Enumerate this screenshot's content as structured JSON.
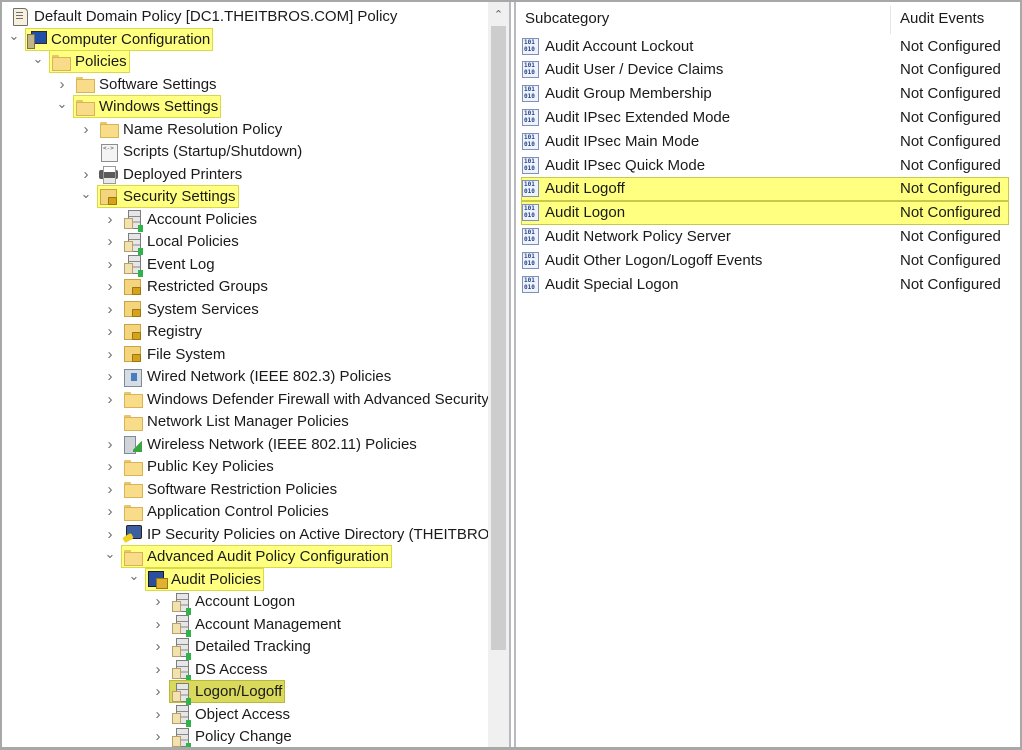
{
  "tree": {
    "root_label": "Default Domain Policy [DC1.THEITBROS.COM] Policy",
    "nodes": [
      {
        "label": "Computer Configuration",
        "icon": "computer-icon",
        "expanded": true,
        "highlighted": true
      },
      {
        "label": "Policies",
        "icon": "folder-icon",
        "expanded": true,
        "highlighted": true
      },
      {
        "label": "Software Settings",
        "icon": "folder-icon",
        "expanded": false
      },
      {
        "label": "Windows Settings",
        "icon": "folder-icon",
        "expanded": true,
        "highlighted": true
      },
      {
        "label": "Name Resolution Policy",
        "icon": "folder-icon",
        "expanded": false
      },
      {
        "label": "Scripts (Startup/Shutdown)",
        "icon": "script-icon"
      },
      {
        "label": "Deployed Printers",
        "icon": "printer-icon",
        "expanded": false
      },
      {
        "label": "Security Settings",
        "icon": "lock-folder-icon",
        "expanded": true,
        "highlighted": true
      },
      {
        "label": "Account Policies",
        "icon": "server-icon",
        "expanded": false
      },
      {
        "label": "Local Policies",
        "icon": "server-icon",
        "expanded": false
      },
      {
        "label": "Event Log",
        "icon": "server-icon",
        "expanded": false
      },
      {
        "label": "Restricted Groups",
        "icon": "lock-folder-icon",
        "expanded": false
      },
      {
        "label": "System Services",
        "icon": "lock-folder-icon",
        "expanded": false
      },
      {
        "label": "Registry",
        "icon": "lock-folder-icon",
        "expanded": false
      },
      {
        "label": "File System",
        "icon": "lock-folder-icon",
        "expanded": false
      },
      {
        "label": "Wired Network (IEEE 802.3) Policies",
        "icon": "wired-network-icon",
        "expanded": false
      },
      {
        "label": "Windows Defender Firewall with Advanced Security",
        "icon": "folder-icon",
        "expanded": false
      },
      {
        "label": "Network List Manager Policies",
        "icon": "folder-icon"
      },
      {
        "label": "Wireless Network (IEEE 802.11) Policies",
        "icon": "wireless-network-icon",
        "expanded": false
      },
      {
        "label": "Public Key Policies",
        "icon": "folder-icon",
        "expanded": false
      },
      {
        "label": "Software Restriction Policies",
        "icon": "folder-icon",
        "expanded": false
      },
      {
        "label": "Application Control Policies",
        "icon": "folder-icon",
        "expanded": false
      },
      {
        "label": "IP Security Policies on Active Directory (THEITBROS.COM)",
        "icon": "ip-security-icon",
        "expanded": false
      },
      {
        "label": "Advanced Audit Policy Configuration",
        "icon": "folder-icon",
        "expanded": true,
        "highlighted": true
      },
      {
        "label": "Audit Policies",
        "icon": "audit-policies-icon",
        "expanded": true,
        "highlighted": true
      },
      {
        "label": "Account Logon",
        "icon": "server-icon",
        "expanded": false
      },
      {
        "label": "Account Management",
        "icon": "server-icon",
        "expanded": false
      },
      {
        "label": "Detailed Tracking",
        "icon": "server-icon",
        "expanded": false
      },
      {
        "label": "DS Access",
        "icon": "server-icon",
        "expanded": false
      },
      {
        "label": "Logon/Logoff",
        "icon": "server-icon",
        "expanded": false,
        "selected": true,
        "highlighted": true
      },
      {
        "label": "Object Access",
        "icon": "server-icon",
        "expanded": false
      },
      {
        "label": "Policy Change",
        "icon": "server-icon",
        "expanded": false
      }
    ]
  },
  "list": {
    "columns": [
      "Subcategory",
      "Audit Events"
    ],
    "rows": [
      {
        "name": "Audit Account Lockout",
        "value": "Not Configured"
      },
      {
        "name": "Audit User / Device Claims",
        "value": "Not Configured"
      },
      {
        "name": "Audit Group Membership",
        "value": "Not Configured"
      },
      {
        "name": "Audit IPsec Extended Mode",
        "value": "Not Configured"
      },
      {
        "name": "Audit IPsec Main Mode",
        "value": "Not Configured"
      },
      {
        "name": "Audit IPsec Quick Mode",
        "value": "Not Configured"
      },
      {
        "name": "Audit Logoff",
        "value": "Not Configured",
        "highlighted": true
      },
      {
        "name": "Audit Logon",
        "value": "Not Configured",
        "highlighted": true
      },
      {
        "name": "Audit Network Policy Server",
        "value": "Not Configured"
      },
      {
        "name": "Audit Other Logon/Logoff Events",
        "value": "Not Configured"
      },
      {
        "name": "Audit Special Logon",
        "value": "Not Configured"
      }
    ]
  },
  "colors": {
    "highlight": "#ffff80",
    "selected_highlight": "#d9d95c",
    "scroll_thumb": "#cdcdcd"
  }
}
